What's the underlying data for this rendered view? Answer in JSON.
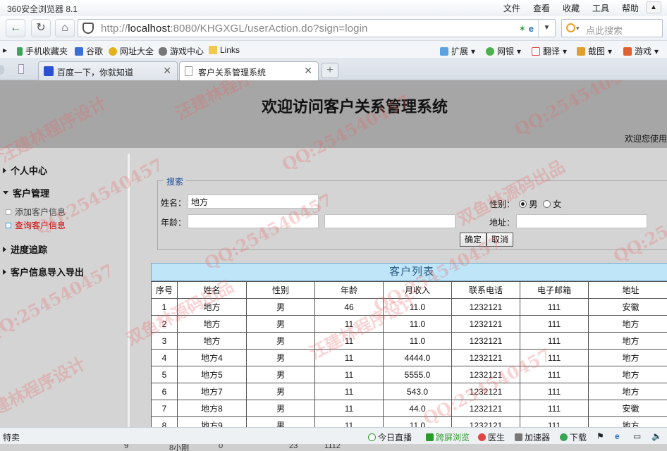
{
  "browser": {
    "window_title": "360安全浏览器 8.1",
    "menus": [
      "文件",
      "查看",
      "收藏",
      "工具",
      "帮助"
    ],
    "address_url_prefix": "http://",
    "address_host": "localhost",
    "address_url_rest": ":8080/KHGXGL/userAction.do?sign=login",
    "search_placeholder": "点此搜索",
    "bookmarks_left": [
      "手机收藏夹",
      "谷歌",
      "网址大全",
      "游戏中心",
      "Links"
    ],
    "bookmarks_right": [
      "扩展",
      "网银",
      "翻译",
      "截图",
      "游戏"
    ],
    "tabs": [
      {
        "label": "百度一下，你就知道",
        "active": false
      },
      {
        "label": "客户关系管理系统",
        "active": true
      }
    ],
    "status_left": "特卖",
    "status_items": [
      "今日直播",
      "跨屏浏览",
      "医生",
      "加速器",
      "下载"
    ]
  },
  "page": {
    "title": "欢迎访问客户关系管理系统",
    "welcome": "欢迎您使用"
  },
  "sidebar": {
    "sections": [
      {
        "label": "个人中心"
      },
      {
        "label": "客户管理"
      },
      {
        "label": "进度追踪"
      },
      {
        "label": "客户信息导入导出"
      }
    ],
    "subitems": [
      {
        "label": "添加客户信息",
        "active": false
      },
      {
        "label": "查询客户信息",
        "active": true
      }
    ]
  },
  "search_form": {
    "legend": "搜索",
    "name_label": "姓名：",
    "name_value": "地方",
    "gender_label": "性别：",
    "gender_male": "男",
    "gender_female": "女",
    "gender_selected": "男",
    "age_label": "年龄：",
    "age_from": "",
    "age_to": "",
    "address_label": "地址：",
    "address_value": "",
    "confirm_label": "确定",
    "cancel_label": "取消"
  },
  "customer_table": {
    "caption": "客户列表",
    "columns": [
      "序号",
      "姓名",
      "性别",
      "年龄",
      "月收入",
      "联系电话",
      "电子邮箱",
      "地址"
    ],
    "rows": [
      [
        "1",
        "地方",
        "男",
        "46",
        "11.0",
        "1232121",
        "111",
        "安徽"
      ],
      [
        "2",
        "地方",
        "男",
        "11",
        "11.0",
        "1232121",
        "111",
        "地方"
      ],
      [
        "3",
        "地方",
        "男",
        "11",
        "11.0",
        "1232121",
        "111",
        "地方"
      ],
      [
        "4",
        "地方4",
        "男",
        "11",
        "4444.0",
        "1232121",
        "111",
        "地方"
      ],
      [
        "5",
        "地方5",
        "男",
        "11",
        "5555.0",
        "1232121",
        "111",
        "地方"
      ],
      [
        "6",
        "地方7",
        "男",
        "11",
        "543.0",
        "1232121",
        "111",
        "地方"
      ],
      [
        "7",
        "地方8",
        "男",
        "11",
        "44.0",
        "1232121",
        "111",
        "安徽"
      ],
      [
        "8",
        "地方9",
        "男",
        "11",
        "11.0",
        "1232121",
        "111",
        "地方"
      ]
    ],
    "partial_row": [
      "9",
      "8小刚",
      "0",
      "23",
      "1112"
    ]
  },
  "watermarks": [
    "QQ:254540457",
    "双鱼林源码出品",
    "汪建林程序设计"
  ],
  "colors": {
    "page_bg": "#d4d4d4",
    "header_bg": "#a6a6a6",
    "caption_bg": "#bee5f8",
    "active_link": "#cc0000",
    "legend": "#1a4f9c"
  }
}
